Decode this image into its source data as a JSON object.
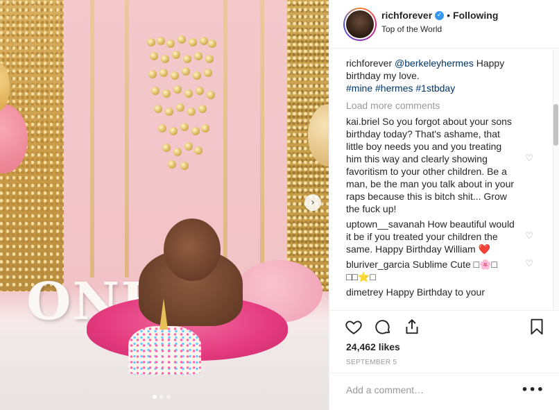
{
  "post": {
    "username": "richforever",
    "verified_mark": "✓",
    "separator": "•",
    "follow_status": "Following",
    "location": "Top of the World"
  },
  "caption": {
    "username": "richforever",
    "mention": "@berkeleyhermes",
    "text": " Happy birthday my love.",
    "hashtags": "#mine #hermes #1stbday"
  },
  "load_more_label": "Load more comments",
  "comments": [
    {
      "username": "kai.briel",
      "text": "So you forgot about your sons birthday today? That's ashame, that little boy needs you and you treating him this way and clearly showing favoritism to your other children. Be a man, be the man you talk about in your raps because this is bitch shit... Grow the fuck up!"
    },
    {
      "username": "uptown__savanah",
      "text": "How beautiful would it be if you treated your children the same. Happy Birthday William ❤️"
    },
    {
      "username": "bluriver_garcia",
      "text": "Sublime Cute □🌸□ □□⭐□"
    },
    {
      "username": "dimetrey",
      "text": "Happy Birthday to your"
    }
  ],
  "icons": {
    "like": "heart-icon",
    "comment": "comment-bubble-icon",
    "share": "share-icon",
    "save": "bookmark-icon",
    "comment_like": "heart-icon",
    "more": "more-options-icon",
    "next": "chevron-right-icon"
  },
  "likes_text": "24,462 likes",
  "date_text": "SEPTEMBER 5",
  "add_comment_placeholder": "Add a comment…",
  "more_label": "•••",
  "next_arrow": "›",
  "colors": {
    "link": "#003569",
    "verified": "#3897f0",
    "muted": "#999999",
    "text": "#262626"
  }
}
